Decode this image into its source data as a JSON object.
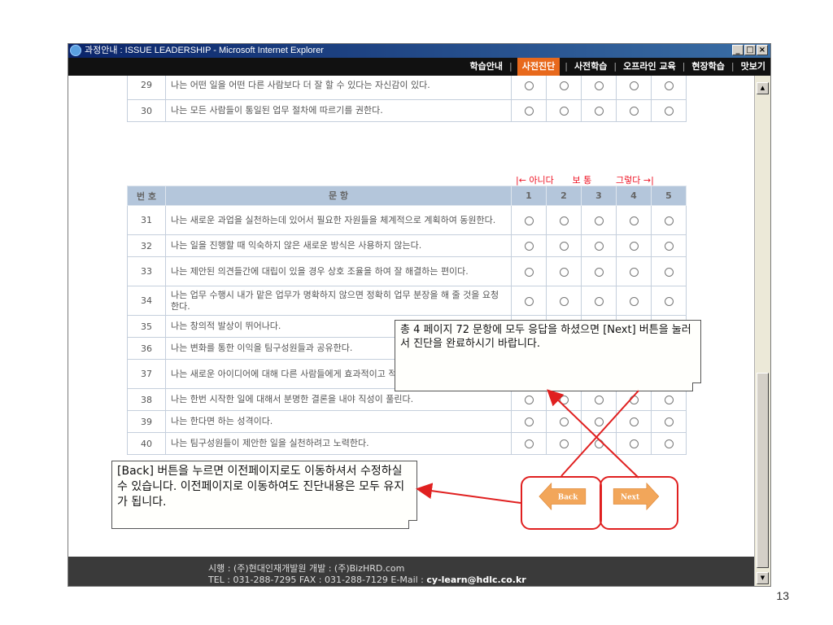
{
  "window": {
    "title": "과정안내 : ISSUE LEADERSHIP - Microsoft Internet Explorer",
    "minimize": "_",
    "maximize": "□",
    "close": "×"
  },
  "nav": {
    "items": [
      "학습안내",
      "사전진단",
      "사전학습",
      "오프라인 교육",
      "현장학습",
      "맛보기"
    ],
    "active_index": 1,
    "separator": "|"
  },
  "table_top": {
    "rows": [
      {
        "no": "29",
        "text": "나는 어떤 일을 어떤 다른 사람보다 더 잘 할 수 있다는 자신감이 있다."
      },
      {
        "no": "30",
        "text": "나는 모든 사람들이 통일된 업무 절차에 따르기를 권한다."
      }
    ]
  },
  "scale": {
    "left": "|← 아니다",
    "middle": "보 통",
    "right": "그렇다 →|"
  },
  "table_main": {
    "header_no": "번 호",
    "header_text": "문 항",
    "options": [
      "1",
      "2",
      "3",
      "4",
      "5"
    ],
    "rows": [
      {
        "no": "31",
        "text": "나는 새로운 과업을 실천하는데 있어서 필요한 자원들을 체계적으로 계획하여 동원한다."
      },
      {
        "no": "32",
        "text": "나는 일을 진행할 때 익숙하지 않은 새로운 방식은 사용하지 않는다."
      },
      {
        "no": "33",
        "text": "나는 제안된 의견들간에 대립이 있을 경우 상호 조율을 하여 잘 해결하는 편이다."
      },
      {
        "no": "34",
        "text": "나는 업무 수행시 내가 맡은 업무가 명확하지 않으면 정확히 업무 분장을 해 줄 것을 요청한다."
      },
      {
        "no": "35",
        "text": "나는 창의적 발상이 뛰어나다."
      },
      {
        "no": "36",
        "text": "나는 변화를 통한 이익을 팀구성원들과 공유한다."
      },
      {
        "no": "37",
        "text": "나는 새로운 아이디어에 대해 다른 사람들에게 효과적이고 적극적으로 설득한다."
      },
      {
        "no": "38",
        "text": "나는 한번 시작한 일에 대해서 분명한 결론을 내야 직성이 풀린다."
      },
      {
        "no": "39",
        "text": "나는 한다면 하는 성격이다."
      },
      {
        "no": "40",
        "text": "나는 팀구성원들이 제안한 일을 실천하려고 노력한다."
      }
    ]
  },
  "buttons": {
    "back": "Back",
    "next": "Next"
  },
  "callouts": {
    "next_note": "총 4 페이지 72 문항에 모두 응답을 하셨으면 [Next] 버튼을 눌러서 진단을 완료하시기 바랍니다.",
    "back_note": "[Back] 버튼을 누르면 이전페이지로도 이동하셔서 수정하실 수 있습니다. 이전페이지로 이동하여도 진단내용은 모두 유지가 됩니다."
  },
  "footer": {
    "line1": "시행 : (주)현대인재개발원   개발 : (주)BizHRD.com",
    "line2_prefix": "TEL : 031-288-7295   FAX : 031-288-7129   E-Mail : ",
    "email": "cy-learn@hdlc.co.kr"
  },
  "slide": {
    "page_number": "13"
  },
  "colors": {
    "accent_orange": "#e8691c",
    "header_blue": "#b4c6db",
    "arrow_red": "#e02020",
    "button_orange": "#f2a65a"
  }
}
